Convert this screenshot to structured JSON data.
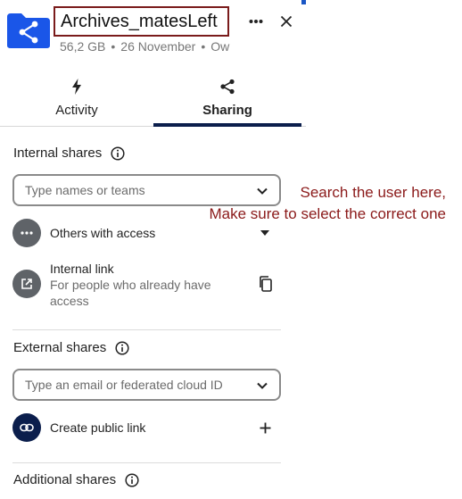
{
  "header": {
    "title": "Archives_matesLeft",
    "size": "56,2 GB",
    "date": "26 November",
    "owner_truncated": "Ow"
  },
  "tabs": [
    {
      "label": "Activity",
      "icon": "lightning-icon"
    },
    {
      "label": "Sharing",
      "icon": "share-icon",
      "active": true
    }
  ],
  "internal_shares": {
    "title": "Internal shares",
    "search_placeholder": "Type names or teams",
    "others_with_access": "Others with access",
    "internal_link": {
      "label": "Internal link",
      "description": "For people who already have access"
    }
  },
  "external_shares": {
    "title": "External shares",
    "search_placeholder": "Type an email or federated cloud ID",
    "create_public_link": "Create public link"
  },
  "additional_shares": {
    "title": "Additional shares"
  },
  "annotation": {
    "line1": "Search the user here,",
    "line2": "Make sure to select the correct one"
  },
  "colors": {
    "folder_blue": "#1a56e8",
    "annotation_red": "#8b1a1a",
    "active_tab_underline": "#0b1e4c",
    "public_link_circle": "#0b1e4c",
    "gray_circle": "#5f6368"
  }
}
